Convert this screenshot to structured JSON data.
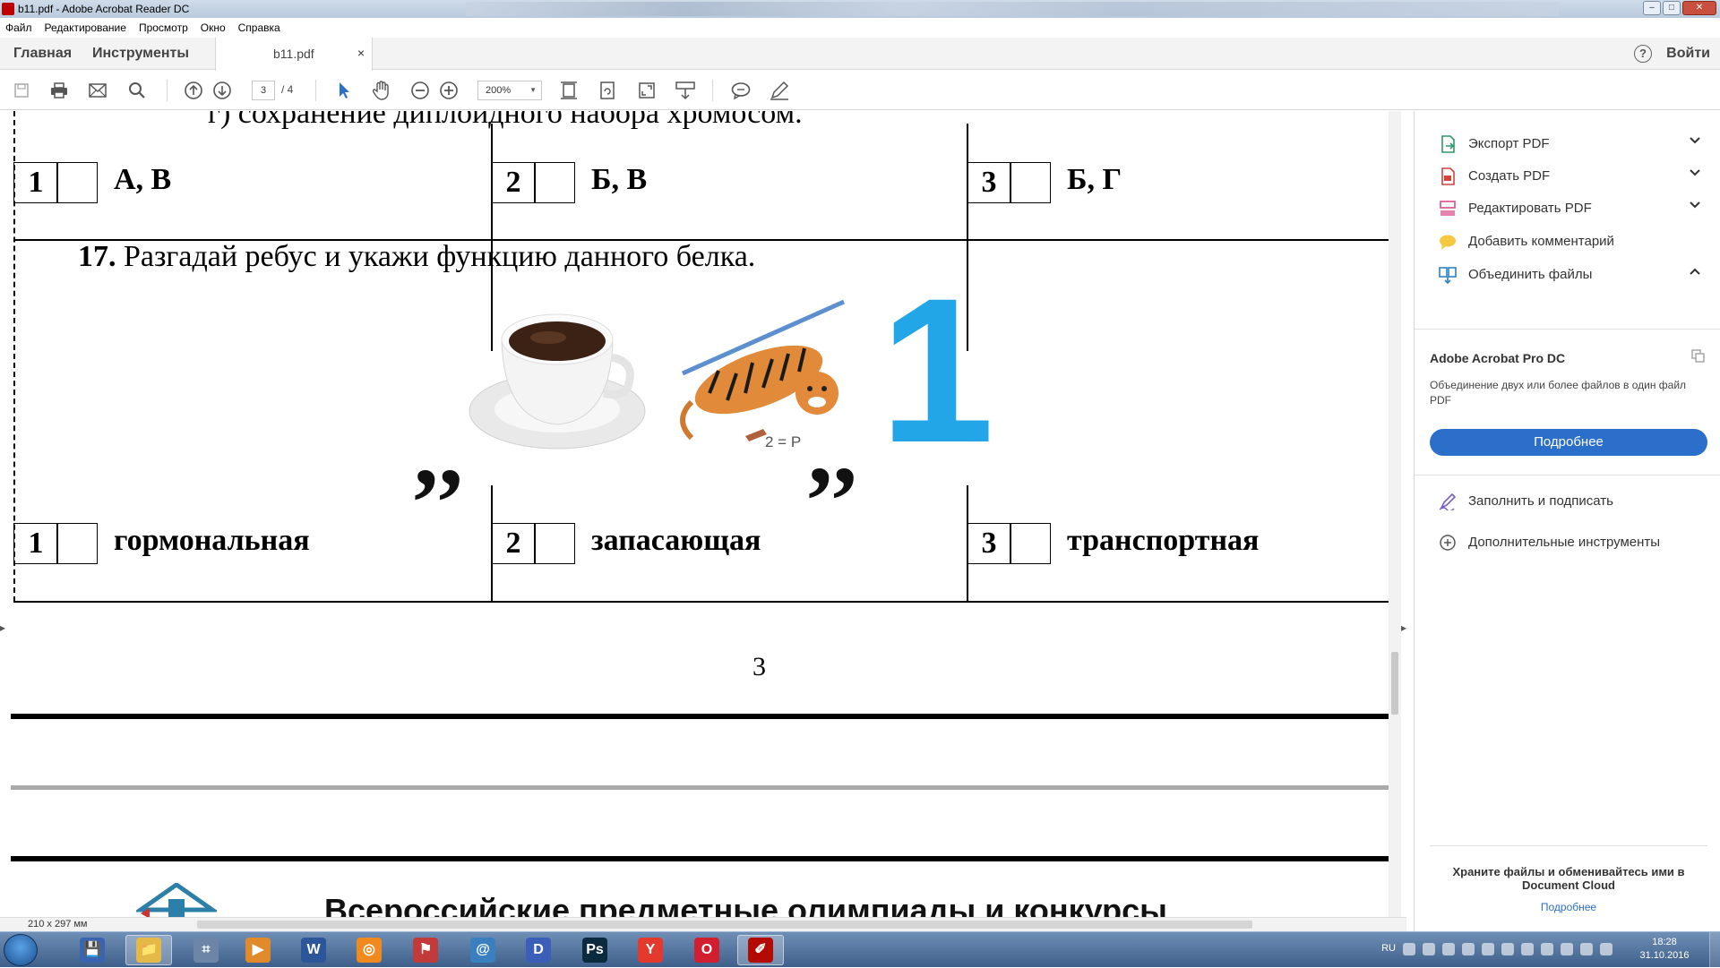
{
  "window": {
    "title": "b11.pdf - Adobe Acrobat Reader DC",
    "controls": [
      "–",
      "□",
      "✕"
    ]
  },
  "menu": {
    "items": [
      "Файл",
      "Редактирование",
      "Просмотр",
      "Окно",
      "Справка"
    ]
  },
  "tabs": {
    "home": "Главная",
    "tools": "Инструменты",
    "document": "b11.pdf",
    "close": "×",
    "help": "?",
    "login": "Войти"
  },
  "toolbar": {
    "page_current": "3",
    "page_total": "/ 4",
    "zoom": "200%",
    "icons": [
      "save-icon",
      "print-icon",
      "mail-icon",
      "search-icon",
      "page-up-icon",
      "page-down-icon",
      "select-arrow-icon",
      "hand-icon",
      "zoom-out-icon",
      "zoom-in-icon",
      "fit-page-icon",
      "rotate-icon",
      "fullscreen-icon",
      "scroll-mode-icon",
      "comment-icon",
      "pen-icon"
    ]
  },
  "document": {
    "cut_line": "г) сохранение диплоидного набора хромосом.",
    "q16_answers": [
      {
        "num": "1",
        "text": "А, В"
      },
      {
        "num": "2",
        "text": "Б, В"
      },
      {
        "num": "3",
        "text": "Б, Г"
      }
    ],
    "q17_number": "17.",
    "q17_text": "Разгадай ребус и укажи функцию данного белка.",
    "rebus_hint": "2 = Р",
    "rebus_digit": "1",
    "q17_answers": [
      {
        "num": "1",
        "text": "гормональная"
      },
      {
        "num": "2",
        "text": "запасающая"
      },
      {
        "num": "3",
        "text": "транспортная"
      }
    ],
    "page_number": "3",
    "footer_title": "Всероссийские предметные олимпиады и конкурсы",
    "page_size": "210 x 297 мм"
  },
  "right_panel": {
    "tools": [
      {
        "label": "Экспорт PDF",
        "icon": "export-pdf-icon",
        "chevron": "⌄"
      },
      {
        "label": "Создать PDF",
        "icon": "create-pdf-icon",
        "chevron": "⌄"
      },
      {
        "label": "Редактировать PDF",
        "icon": "edit-pdf-icon",
        "chevron": "⌄"
      },
      {
        "label": "Добавить комментарий",
        "icon": "comment-bubble-icon",
        "chevron": ""
      },
      {
        "label": "Объединить файлы",
        "icon": "combine-files-icon",
        "chevron": "⌃"
      }
    ],
    "promo_title": "Adobe Acrobat Pro DC",
    "promo_desc": "Объединение двух или более файлов в один файл PDF",
    "promo_button": "Подробнее",
    "extra_tools": [
      {
        "label": "Заполнить и подписать",
        "icon": "sign-pen-icon"
      },
      {
        "label": "Дополнительные инструменты",
        "icon": "plus-circle-icon"
      }
    ],
    "bottom_title": "Храните файлы и обменивайтесь ими в Document Cloud",
    "bottom_link": "Подробнее"
  },
  "taskbar": {
    "apps": [
      {
        "name": "save-app",
        "glyph": "💾",
        "color": "#3a64b0"
      },
      {
        "name": "explorer-app",
        "glyph": "📁",
        "color": "#e4b948"
      },
      {
        "name": "calculator-app",
        "glyph": "⌗",
        "color": "#6d86a8"
      },
      {
        "name": "media-app",
        "glyph": "▶",
        "color": "#e08a2a"
      },
      {
        "name": "word-app",
        "glyph": "W",
        "color": "#2b579a"
      },
      {
        "name": "burn-app",
        "glyph": "◎",
        "color": "#f08a1f"
      },
      {
        "name": "flag-app",
        "glyph": "⚑",
        "color": "#c33a3a"
      },
      {
        "name": "network-app",
        "glyph": "@",
        "color": "#3a80c0"
      },
      {
        "name": "video-app",
        "glyph": "D",
        "color": "#3b5fb8"
      },
      {
        "name": "photoshop-app",
        "glyph": "Ps",
        "color": "#0b2a3e"
      },
      {
        "name": "yandex-app",
        "glyph": "Y",
        "color": "#e43a2e"
      },
      {
        "name": "opera-app",
        "glyph": "O",
        "color": "#d21f2f"
      },
      {
        "name": "acrobat-app",
        "glyph": "✐",
        "color": "#b30b00"
      }
    ],
    "lang": "RU",
    "time": "18:28",
    "date": "31.10.2016"
  },
  "colors": {
    "accent": "#2b6fcb",
    "acrobat_red": "#b30b00",
    "rebus_blue": "#22a6e8"
  }
}
